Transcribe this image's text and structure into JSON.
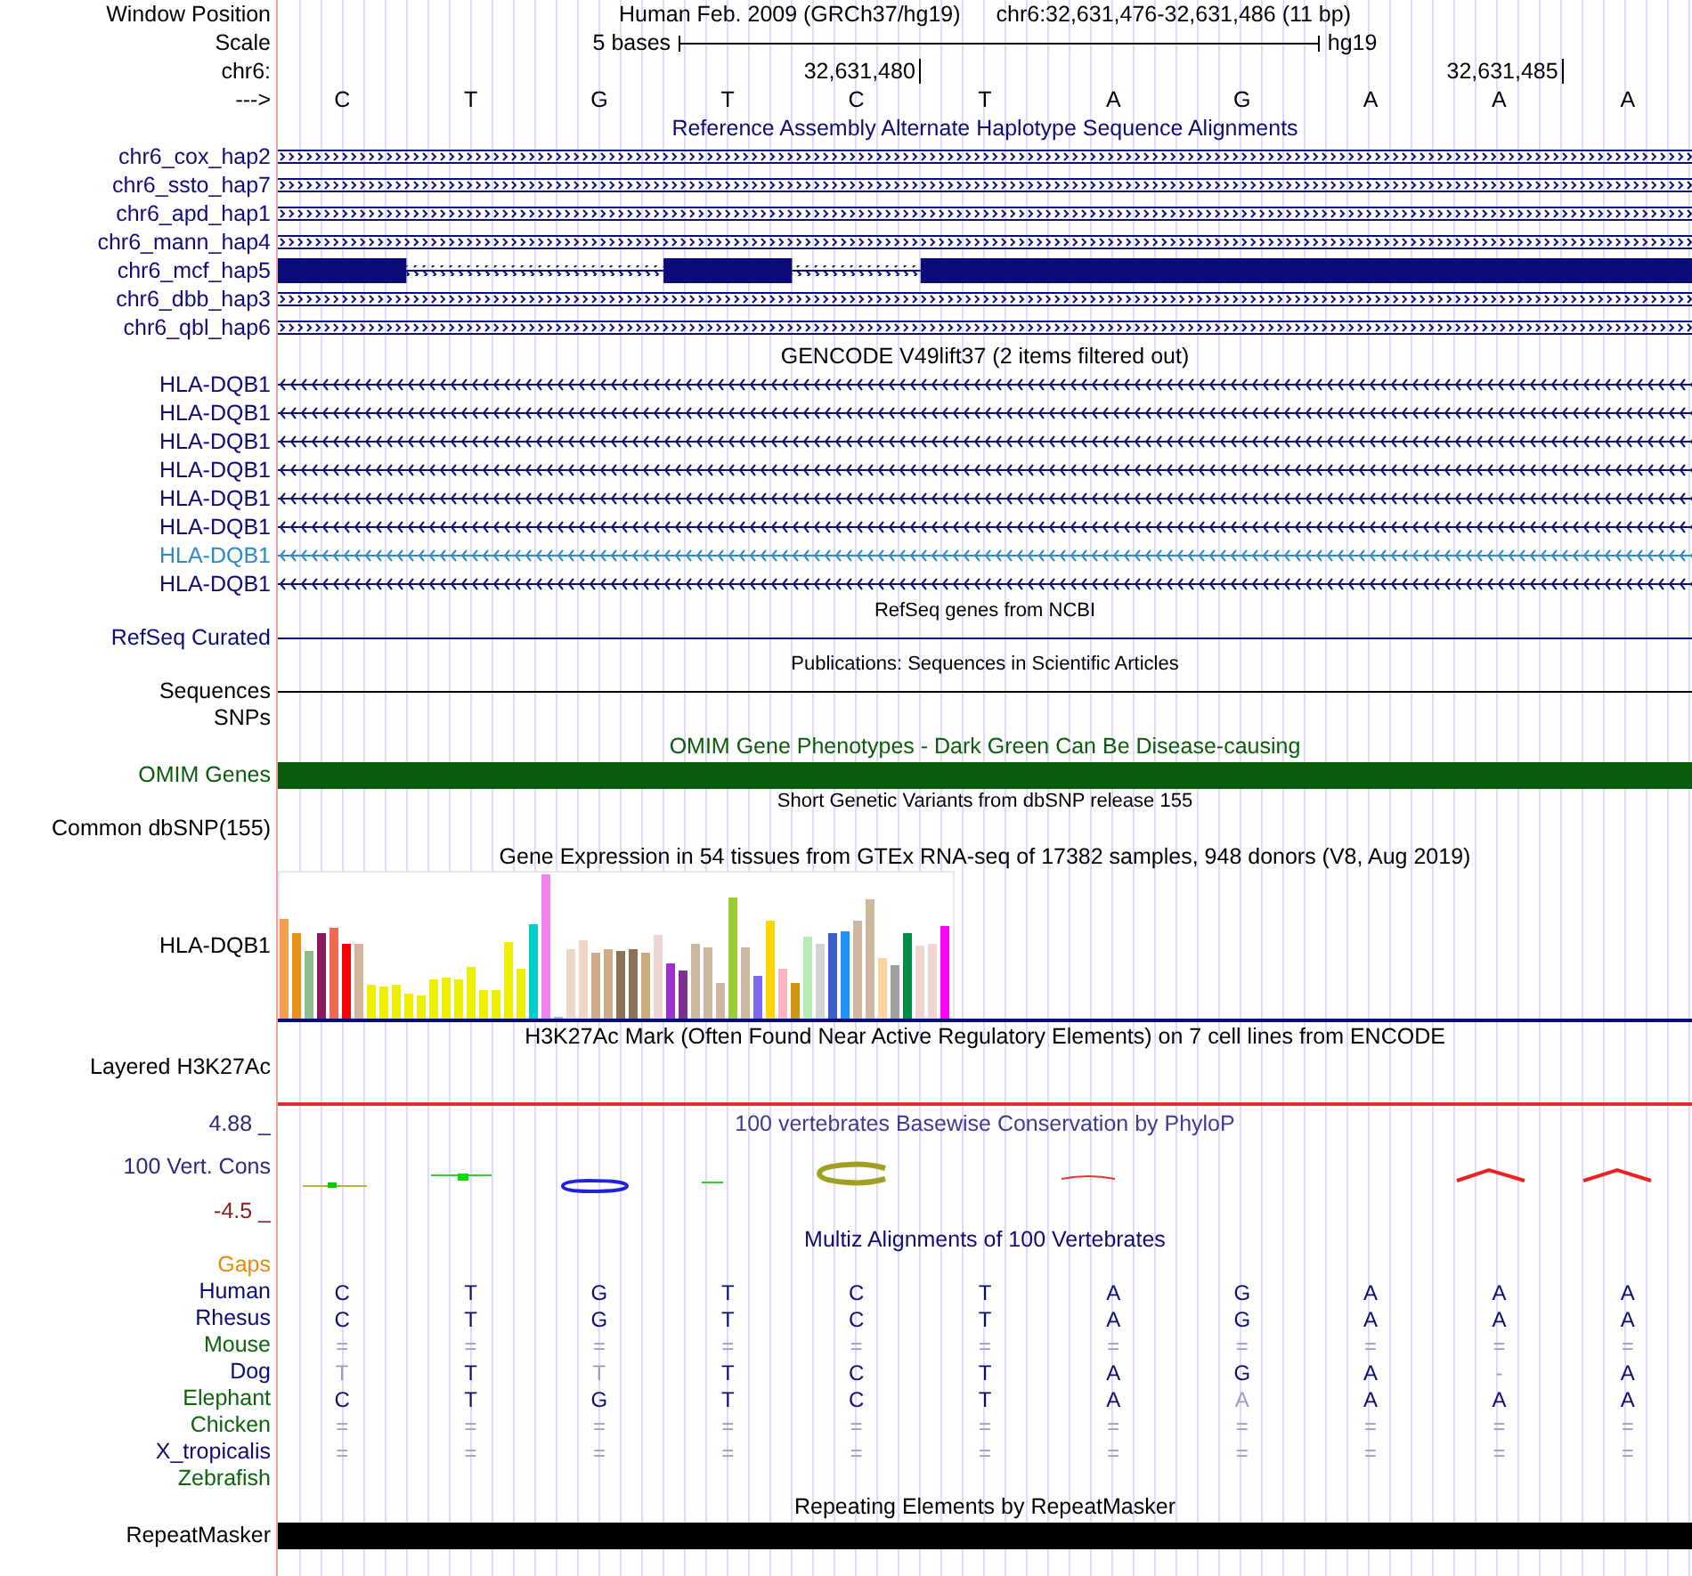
{
  "window_position": {
    "label": "Window Position",
    "assembly": "Human Feb. 2009 (GRCh37/hg19)",
    "range": "chr6:32,631,476-32,631,486 (11 bp)"
  },
  "scale": {
    "label": "Scale",
    "length": "5 bases",
    "assembly": "hg19"
  },
  "chromosome": {
    "label": "chr6:",
    "strand": "--->",
    "bases": [
      {
        "base": "C"
      },
      {
        "base": "T"
      },
      {
        "base": "G"
      },
      {
        "base": "T"
      },
      {
        "base": "C",
        "tick": "32,631,480"
      },
      {
        "base": "T"
      },
      {
        "base": "A"
      },
      {
        "base": "G"
      },
      {
        "base": "A"
      },
      {
        "base": "A",
        "tick": "32,631,485"
      },
      {
        "base": "A"
      }
    ]
  },
  "tracks": [
    {
      "kind": "alignments",
      "title": "Reference Assembly Alternate Haplotype Sequence Alignments",
      "color": "#0c0c78",
      "rows": [
        {
          "label": "chr6_cox_hap2",
          "kind": "chain"
        },
        {
          "label": "chr6_ssto_hap7",
          "kind": "chain"
        },
        {
          "label": "chr6_apd_hap1",
          "kind": "chain"
        },
        {
          "label": "chr6_mann_hap4",
          "kind": "chain"
        },
        {
          "label": "chr6_mcf_hap5",
          "kind": "gapped",
          "aligned": [
            true,
            false,
            false,
            true,
            false,
            true,
            true,
            true,
            true,
            true,
            true
          ]
        },
        {
          "label": "chr6_dbb_hap3",
          "kind": "chain"
        },
        {
          "label": "chr6_qbl_hap6",
          "kind": "chain"
        }
      ]
    },
    {
      "kind": "genes",
      "title": "GENCODE V49lift37 (2 items filtered out)",
      "rows": [
        {
          "label": "HLA-DQB1",
          "color": "#0c0c78"
        },
        {
          "label": "HLA-DQB1",
          "color": "#0c0c78"
        },
        {
          "label": "HLA-DQB1",
          "color": "#0c0c78"
        },
        {
          "label": "HLA-DQB1",
          "color": "#0c0c78"
        },
        {
          "label": "HLA-DQB1",
          "color": "#0c0c78"
        },
        {
          "label": "HLA-DQB1",
          "color": "#0c0c78"
        },
        {
          "label": "HLA-DQB1",
          "color": "#2a8bc7"
        },
        {
          "label": "HLA-DQB1",
          "color": "#0c0c78"
        }
      ]
    },
    {
      "kind": "line",
      "title": "RefSeq genes from NCBI",
      "label": "RefSeq Curated",
      "color": "#0c0c78"
    },
    {
      "kind": "line",
      "title": "Publications: Sequences in Scientific Articles",
      "label": "Sequences",
      "color": "#000000"
    },
    {
      "kind": "blank",
      "label": "SNPs"
    },
    {
      "kind": "bar",
      "title": "OMIM Gene Phenotypes - Dark Green Can Be Disease-causing",
      "label": "OMIM Genes",
      "color": "#0a5c0a"
    },
    {
      "kind": "blank",
      "title": "Short Genetic Variants from dbSNP release 155",
      "label": "Common dbSNP(155)"
    },
    {
      "kind": "expression",
      "title": "Gene Expression in 54 tissues from GTEx RNA-seq of 17382 samples, 948 donors (V8, Aug 2019)",
      "label": "HLA-DQB1"
    },
    {
      "kind": "signal",
      "title": "H3K27Ac Mark (Often Found Near Active Regulatory Elements) on 7 cell lines from ENCODE",
      "label": "Layered H3K27Ac"
    },
    {
      "kind": "conservation",
      "title": "100 vertebrates Basewise Conservation by PhyloP",
      "label": "100 Vert. Cons",
      "max": "4.88 _",
      "min": "-4.5 _"
    },
    {
      "kind": "multiz",
      "title": "Multiz Alignments of 100 Vertebrates",
      "rows": [
        {
          "label": "Gaps",
          "color": "#e8890c"
        },
        {
          "label": "Human",
          "color": "#0c0c78",
          "cells": [
            "C",
            "T",
            "G",
            "T",
            "C",
            "T",
            "A",
            "G",
            "A",
            "A",
            "A"
          ],
          "faint": [
            false,
            false,
            false,
            false,
            false,
            false,
            false,
            false,
            false,
            false,
            false
          ]
        },
        {
          "label": "Rhesus",
          "color": "#0c0c78",
          "cells": [
            "C",
            "T",
            "G",
            "T",
            "C",
            "T",
            "A",
            "G",
            "A",
            "A",
            "A"
          ],
          "faint": [
            false,
            false,
            false,
            false,
            false,
            false,
            false,
            false,
            false,
            false,
            false
          ]
        },
        {
          "label": "Mouse",
          "color": "#0b640b",
          "cells": [
            "=",
            "=",
            "=",
            "=",
            "=",
            "=",
            "=",
            "=",
            "=",
            "=",
            "="
          ],
          "faint": [
            true,
            true,
            true,
            true,
            true,
            true,
            true,
            true,
            true,
            true,
            true
          ]
        },
        {
          "label": "Dog",
          "color": "#0c0c78",
          "cells": [
            "T",
            "T",
            "T",
            "T",
            "C",
            "T",
            "A",
            "G",
            "A",
            "-",
            "A"
          ],
          "faint": [
            true,
            false,
            true,
            false,
            false,
            false,
            false,
            false,
            false,
            true,
            false
          ]
        },
        {
          "label": "Elephant",
          "color": "#0b640b",
          "cells": [
            "C",
            "T",
            "G",
            "T",
            "C",
            "T",
            "A",
            "A",
            "A",
            "A",
            "A"
          ],
          "faint": [
            false,
            false,
            false,
            false,
            false,
            false,
            false,
            true,
            false,
            false,
            false
          ]
        },
        {
          "label": "Chicken",
          "color": "#0b640b",
          "cells": [
            "=",
            "=",
            "=",
            "=",
            "=",
            "=",
            "=",
            "=",
            "=",
            "=",
            "="
          ],
          "faint": [
            true,
            true,
            true,
            true,
            true,
            true,
            true,
            true,
            true,
            true,
            true
          ]
        },
        {
          "label": "X_tropicalis",
          "color": "#0c0c78",
          "cells": [
            "=",
            "=",
            "=",
            "=",
            "=",
            "=",
            "=",
            "=",
            "=",
            "=",
            "="
          ],
          "faint": [
            true,
            true,
            true,
            true,
            true,
            true,
            true,
            true,
            true,
            true,
            true
          ]
        },
        {
          "label": "Zebrafish",
          "color": "#0b640b"
        }
      ]
    },
    {
      "kind": "bar",
      "title": "Repeating Elements by RepeatMasker",
      "label": "RepeatMasker",
      "color": "#000000"
    }
  ]
}
